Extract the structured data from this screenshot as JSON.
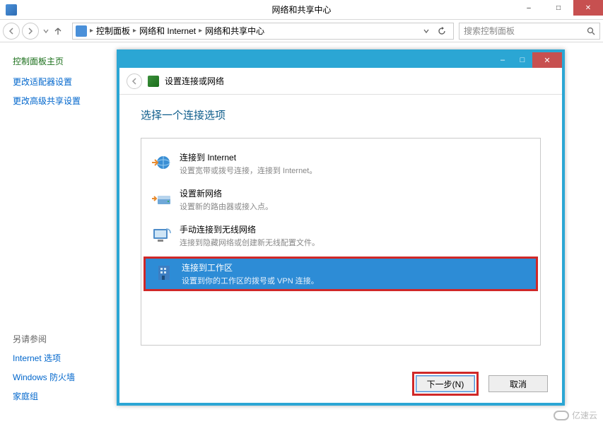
{
  "parent_window": {
    "title": "网络和共享中心",
    "controls": {
      "min": "–",
      "max": "□",
      "close": "✕"
    }
  },
  "toolbar": {
    "breadcrumb": [
      "控制面板",
      "网络和 Internet",
      "网络和共享中心"
    ],
    "search_placeholder": "搜索控制面板"
  },
  "sidebar": {
    "heading": "控制面板主页",
    "links_top": [
      "更改适配器设置",
      "更改高级共享设置"
    ],
    "section_label": "另请参阅",
    "links_bottom": [
      "Internet 选项",
      "Windows 防火墙",
      "家庭组"
    ]
  },
  "dialog": {
    "title": "设置连接或网络",
    "heading": "选择一个连接选项",
    "options": [
      {
        "title": "连接到 Internet",
        "desc": "设置宽带或拨号连接，连接到 Internet。"
      },
      {
        "title": "设置新网络",
        "desc": "设置新的路由器或接入点。"
      },
      {
        "title": "手动连接到无线网络",
        "desc": "连接到隐藏网络或创建新无线配置文件。"
      },
      {
        "title": "连接到工作区",
        "desc": "设置到你的工作区的拨号或 VPN 连接。"
      }
    ],
    "next_label": "下一步(N)",
    "cancel_label": "取消"
  },
  "watermark": "亿速云"
}
